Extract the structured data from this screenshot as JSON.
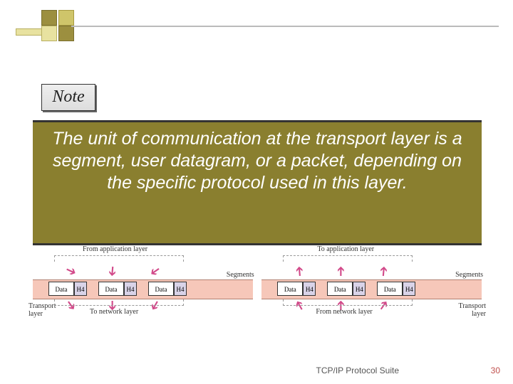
{
  "note_label": "Note",
  "main_message": "The unit of communication at the transport layer is a segment, user datagram, or a packet, depending on the specific protocol used in this layer.",
  "diagram": {
    "left": {
      "top_label": "From application layer",
      "segments_label": "Segments",
      "cells": [
        "Data",
        "H4",
        "Data",
        "H4",
        "Data",
        "H4"
      ],
      "side_label": "Transport\nlayer",
      "bottom_label": "To network layer"
    },
    "right": {
      "top_label": "To application layer",
      "segments_label": "Segments",
      "cells": [
        "Data",
        "H4",
        "Data",
        "H4",
        "Data",
        "H4"
      ],
      "side_label": "Transport\nlayer",
      "bottom_label": "From network layer"
    }
  },
  "footer": {
    "text": "TCP/IP Protocol Suite",
    "page": "30"
  }
}
